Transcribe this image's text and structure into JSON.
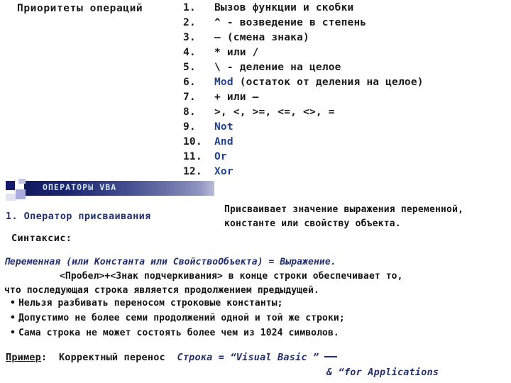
{
  "slide": {
    "title": "Приоритеты операций",
    "section_header": "ОПЕРАТОРЫ VBA"
  },
  "priority_list": {
    "items": [
      {
        "num": "1.",
        "text": "Вызов функции и скобки",
        "keyword": ""
      },
      {
        "num": "2.",
        "text": "^ - возведение в степень",
        "keyword": ""
      },
      {
        "num": "3.",
        "text": "– (смена знака)",
        "keyword": ""
      },
      {
        "num": "4.",
        "text": "* или /",
        "keyword": ""
      },
      {
        "num": "5.",
        "text": "\\ - деление на целое",
        "keyword": ""
      },
      {
        "num": "6.",
        "text": " (остаток от деления на целое)",
        "keyword": "Mod"
      },
      {
        "num": "7.",
        "text": "+ или –",
        "keyword": ""
      },
      {
        "num": "8.",
        "text": ">, <, >=, <=, <>, =",
        "keyword": ""
      },
      {
        "num": "9.",
        "text": "Not",
        "keyword": "all"
      },
      {
        "num": "10.",
        "text": "And",
        "keyword": "all"
      },
      {
        "num": "11.",
        "text": "Or",
        "keyword": "all"
      },
      {
        "num": "12.",
        "text": "Xor",
        "keyword": "all"
      }
    ]
  },
  "operator_section": {
    "title": "1. Оператор присваивания",
    "syntax_label": "Синтаксис:",
    "description": "Присваивает значение выражения переменной, константе или свойству объекта.",
    "syntax_line": "Переменная (или Константа или СвойствоОбъекта) = Выражение.",
    "continuation_rule": "<Пробел>+<Знак подчеркивания> в конце строки обеспечивает то,",
    "continuation_rule_line2": "что последующая строка является продолжением предыдущей.",
    "bullets": [
      "Нельзя разбивать переносом строковые константы;",
      "Допустимо не более семи продолжений одной и той же строки;",
      "Сама строка не может состоять более чем из 1024 символов."
    ],
    "bullet_marker": "•"
  },
  "example": {
    "label": "Пример",
    "separator": ":",
    "lead_text": "Корректный перенос",
    "code_line1": "Строка = “Visual Basic ”",
    "code_line2": "& “for Applications"
  },
  "colors": {
    "keyword_blue": "#1f3f8f",
    "heading_navy": "#23306e",
    "header_bar_dark": "#131a5e",
    "header_bar_light": "#b9bcd8",
    "header_text": "#cfe9e6",
    "body_text": "#151515"
  }
}
